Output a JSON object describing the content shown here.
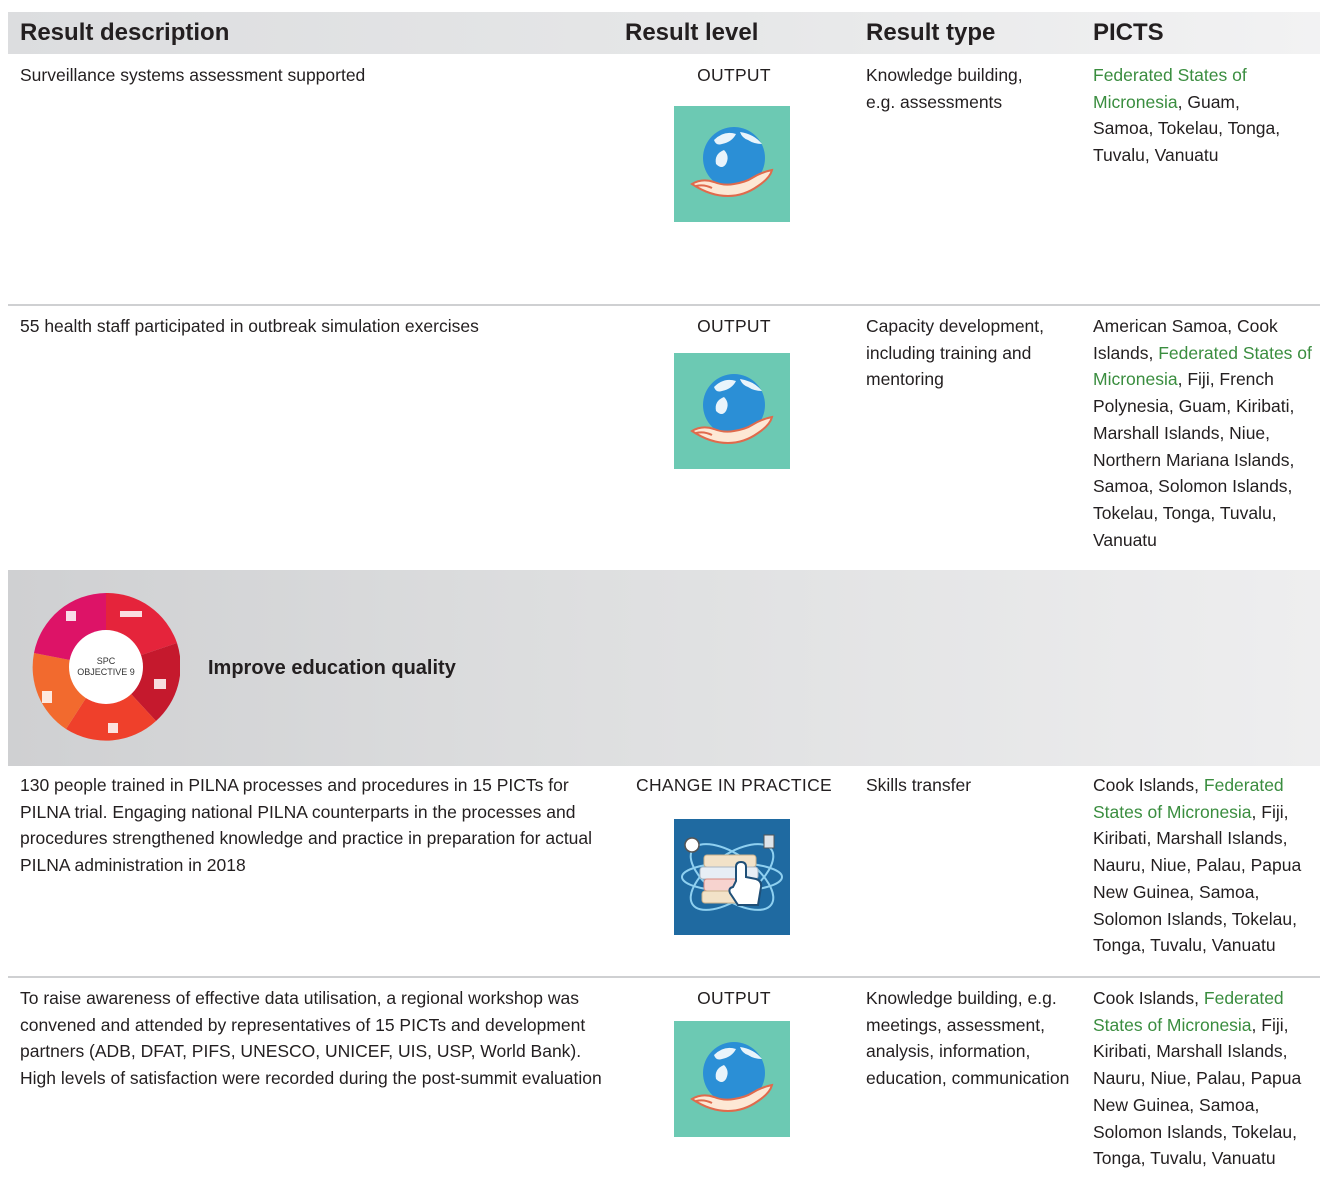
{
  "header": {
    "result_description": "Result description",
    "result_level": "Result level",
    "result_type": "Result type",
    "picts": "PICTS"
  },
  "rows": [
    {
      "description": "Surveillance systems assessment supported",
      "level": "OUTPUT",
      "type": "Knowledge building, e.g. assessments",
      "picts_green": "Federated States of Micronesia",
      "picts_rest": ", Guam, Samoa, Tokelau, Tonga, Tuvalu, Vanuatu",
      "icon": "hand-globe-icon"
    },
    {
      "description": "55 health staff participated in outbreak simulation exercises",
      "level": "OUTPUT",
      "type": "Capacity development, including training and mentoring",
      "picts_before": "American Samoa, Cook Islands, ",
      "picts_green": "Federated States of Micronesia",
      "picts_rest": ", Fiji, French Polynesia, Guam, Kiribati, Marshall Islands, Niue, Northern Mariana Islands, Samoa, Solomon Islands, Tokelau, Tonga, Tuvalu, Vanuatu",
      "icon": "hand-globe-icon"
    },
    {
      "description": "130 people trained in PILNA processes and procedures in 15 PICTs for PILNA trial. Engaging national PILNA counterparts in the processes and procedures strengthened knowledge and practice in preparation for actual PILNA administration in 2018",
      "level": "CHANGE IN PRACTICE",
      "type": "Skills transfer",
      "picts_before": "Cook Islands, ",
      "picts_green": "Federated States of Micronesia",
      "picts_rest": ", Fiji, Kiribati, Marshall Islands, Nauru, Niue, Palau, Papua New Guinea, Samoa, Solomon Islands, Tokelau, Tonga, Tuvalu, Vanuatu",
      "icon": "books-touch-icon"
    },
    {
      "description": "To raise awareness of effective data utilisation, a regional workshop was convened and attended by representatives of 15 PICTs and development partners (ADB, DFAT, PIFS, UNESCO, UNICEF, UIS, USP, World Bank). High levels of satisfaction were recorded during the post-summit evaluation",
      "level": "OUTPUT",
      "type": "Knowledge building, e.g. meetings, assessment, analysis, information, education, communication",
      "picts_before": "Cook Islands, ",
      "picts_green": "Federated States of Micronesia",
      "picts_rest": ", Fiji, Kiribati, Marshall Islands, Nauru, Niue, Palau, Papua New Guinea, Samoa, Solomon Islands, Tokelau, Tonga, Tuvalu, Vanuatu",
      "icon": "hand-globe-icon"
    }
  ],
  "objective": {
    "wheel_line1": "SPC",
    "wheel_line2": "OBJECTIVE 9",
    "title": "Improve education quality"
  },
  "colors": {
    "green_link": "#3a8d3f",
    "teal_icon_bg": "#6cc9b3",
    "blue_icon_bg": "#1f6aa1"
  }
}
